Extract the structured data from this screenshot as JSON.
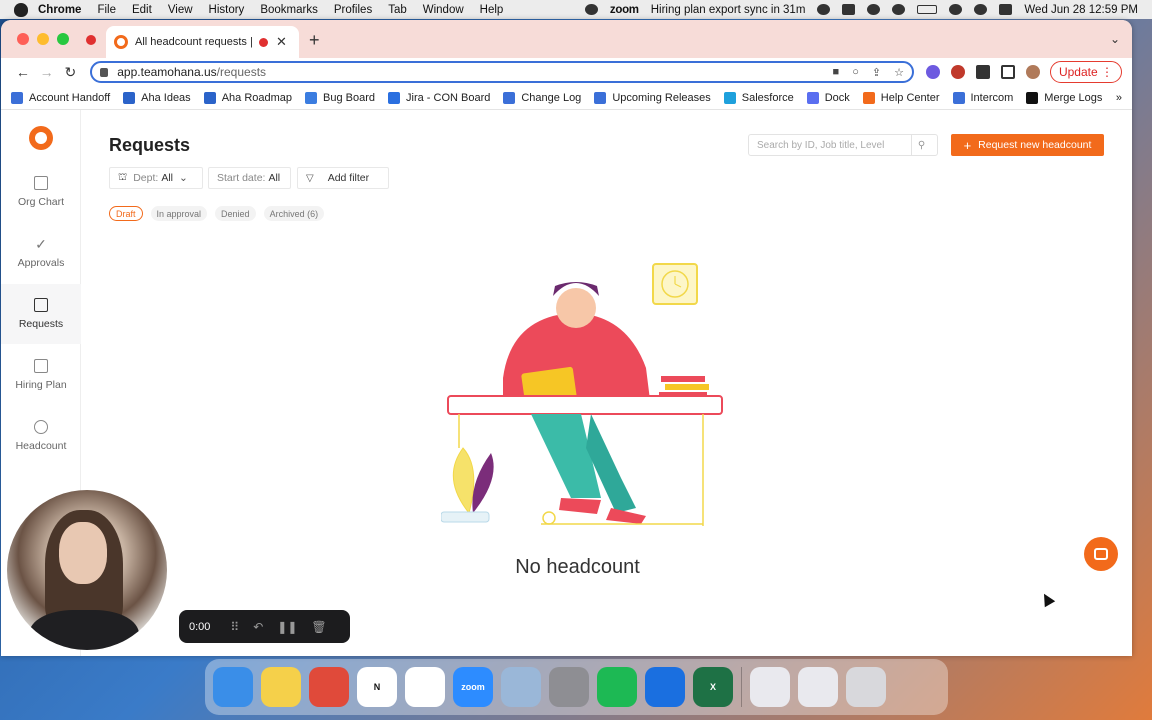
{
  "menubar": {
    "app": "Chrome",
    "items": [
      "File",
      "Edit",
      "View",
      "History",
      "Bookmarks",
      "Profiles",
      "Tab",
      "Window",
      "Help"
    ],
    "zoom_label": "zoom",
    "notification": "Hiring plan export sync in 31m",
    "datetime": "Wed Jun 28  12:59 PM"
  },
  "browser": {
    "tab_title": "All headcount requests | Te",
    "url_host": "app.teamohana.us",
    "url_path": "/requests",
    "update_label": "Update",
    "bookmarks": [
      {
        "label": "Account Handoff",
        "color": "#3b6fd8"
      },
      {
        "label": "Aha Ideas",
        "color": "#2b63c9"
      },
      {
        "label": "Aha Roadmap",
        "color": "#2b63c9"
      },
      {
        "label": "Bug Board",
        "color": "#3b7de0"
      },
      {
        "label": "Jira - CON Board",
        "color": "#2a6fe0"
      },
      {
        "label": "Change Log",
        "color": "#3b6fd8"
      },
      {
        "label": "Upcoming Releases",
        "color": "#3b6fd8"
      },
      {
        "label": "Salesforce",
        "color": "#1ea0dc"
      },
      {
        "label": "Dock",
        "color": "#5a6ef0"
      },
      {
        "label": "Help Center",
        "color": "#f26a1b"
      },
      {
        "label": "Intercom",
        "color": "#3b6fd8"
      },
      {
        "label": "Merge Logs",
        "color": "#111111"
      }
    ],
    "bookmarks_more": "»"
  },
  "sidebar": {
    "items": [
      {
        "label": "Org Chart",
        "icon": "org-chart-icon"
      },
      {
        "label": "Approvals",
        "icon": "check-icon"
      },
      {
        "label": "Requests",
        "icon": "document-icon"
      },
      {
        "label": "Hiring Plan",
        "icon": "calendar-icon"
      },
      {
        "label": "Headcount",
        "icon": "people-icon"
      }
    ],
    "active": "Requests"
  },
  "page": {
    "title": "Requests",
    "search_placeholder": "Search by ID, Job title, Level",
    "request_button": "Request new headcount",
    "filters": {
      "dept_label": "Dept:",
      "dept_value": "All",
      "start_label": "Start date:",
      "start_value": "All",
      "add_filter": "Add filter"
    },
    "status_tabs": [
      "Draft",
      "In approval",
      "Denied",
      "Archived (6)"
    ],
    "active_status": "Draft",
    "empty_message": "No headcount"
  },
  "recorder": {
    "time": "0:00"
  },
  "dock": {
    "apps": [
      {
        "name": "Finder",
        "color": "#3a8ee8",
        "glyph": ""
      },
      {
        "name": "Notes",
        "color": "#f5d04a",
        "glyph": ""
      },
      {
        "name": "Chrome",
        "color": "#e04a3a",
        "glyph": ""
      },
      {
        "name": "Notion",
        "color": "#ffffff",
        "glyph": "N"
      },
      {
        "name": "Slack",
        "color": "#ffffff",
        "glyph": ""
      },
      {
        "name": "Zoom",
        "color": "#2d8cff",
        "glyph": "zoom"
      },
      {
        "name": "Preview",
        "color": "#9ab7d8",
        "glyph": ""
      },
      {
        "name": "System Settings",
        "color": "#8e8e93",
        "glyph": ""
      },
      {
        "name": "Spotify",
        "color": "#1db954",
        "glyph": ""
      },
      {
        "name": "Directory",
        "color": "#1a6fe0",
        "glyph": ""
      },
      {
        "name": "Excel",
        "color": "#1e7145",
        "glyph": "X"
      },
      {
        "name": "Chrome App",
        "color": "#e9e9ee",
        "glyph": ""
      },
      {
        "name": "Chrome Shortcut",
        "color": "#e9e9ee",
        "glyph": ""
      },
      {
        "name": "Trash",
        "color": "#d8d8dc",
        "glyph": ""
      }
    ]
  }
}
